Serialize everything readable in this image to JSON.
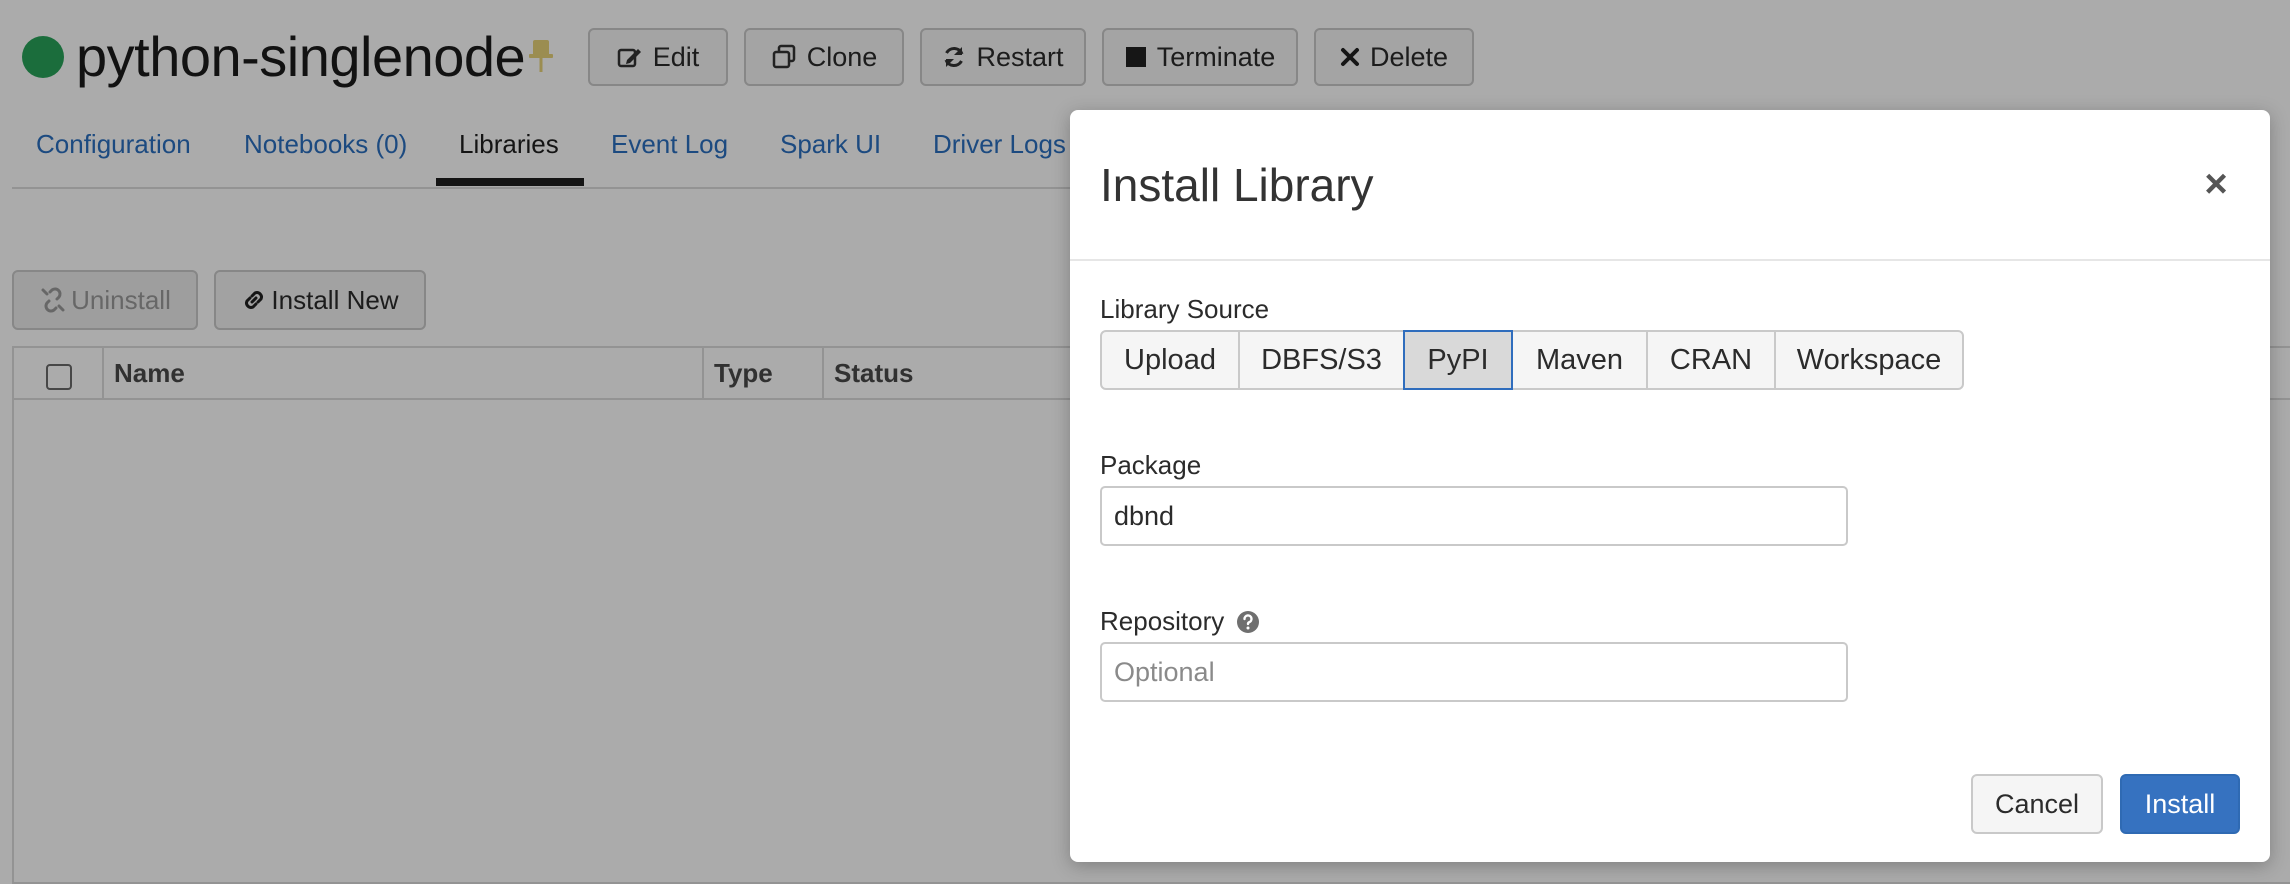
{
  "cluster": {
    "name": "python-singlenode",
    "status_color": "#29a35a",
    "pin_color": "#e8d37a"
  },
  "header_buttons": {
    "edit": "Edit",
    "clone": "Clone",
    "restart": "Restart",
    "terminate": "Terminate",
    "delete": "Delete"
  },
  "tabs": [
    {
      "label": "Configuration",
      "active": false
    },
    {
      "label": "Notebooks (0)",
      "active": false
    },
    {
      "label": "Libraries",
      "active": true
    },
    {
      "label": "Event Log",
      "active": false
    },
    {
      "label": "Spark UI",
      "active": false
    },
    {
      "label": "Driver Logs",
      "active": false
    }
  ],
  "libraries_toolbar": {
    "uninstall": "Uninstall",
    "install_new": "Install New"
  },
  "table": {
    "columns": [
      "Name",
      "Type",
      "Status"
    ]
  },
  "modal": {
    "title": "Install Library",
    "close_symbol": "×",
    "library_source_label": "Library Source",
    "sources": [
      "Upload",
      "DBFS/S3",
      "PyPI",
      "Maven",
      "CRAN",
      "Workspace"
    ],
    "selected_source": "PyPI",
    "package_label": "Package",
    "package_value": "dbnd",
    "repository_label": "Repository",
    "repository_placeholder": "Optional",
    "cancel": "Cancel",
    "install": "Install"
  },
  "colors": {
    "link": "#2a6fbf",
    "primary": "#3672c0",
    "overlay": "rgba(0,0,0,0.33)"
  }
}
